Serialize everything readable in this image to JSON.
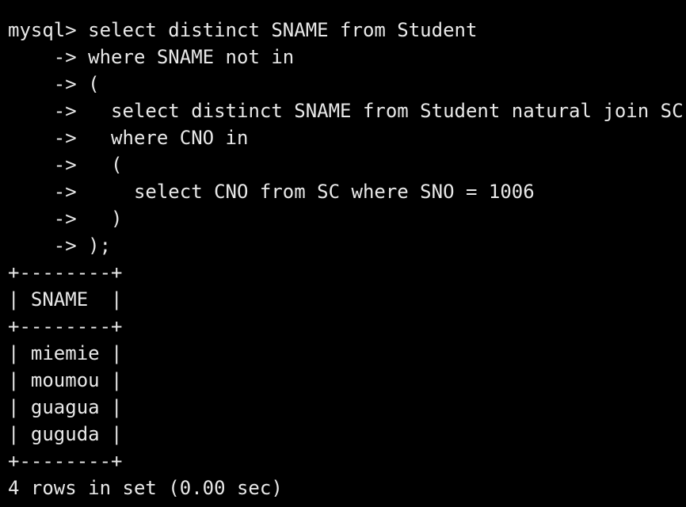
{
  "colors": {
    "background": "#000000",
    "text": "#e8e8e8"
  },
  "query": {
    "prompt": "mysql> ",
    "continuation": "    -> ",
    "lines": [
      "select distinct SNAME from Student",
      "where SNAME not in",
      "(",
      "  select distinct SNAME from Student natural join SC",
      "  where CNO in",
      "  (",
      "    select CNO from SC where SNO = 1006",
      "  )",
      ");"
    ]
  },
  "result": {
    "border": "+--------+",
    "header_row": "| SNAME  |",
    "rows": [
      "| miemie |",
      "| moumou |",
      "| guagua |",
      "| guguda |"
    ],
    "status": "4 rows in set (0.00 sec)"
  }
}
